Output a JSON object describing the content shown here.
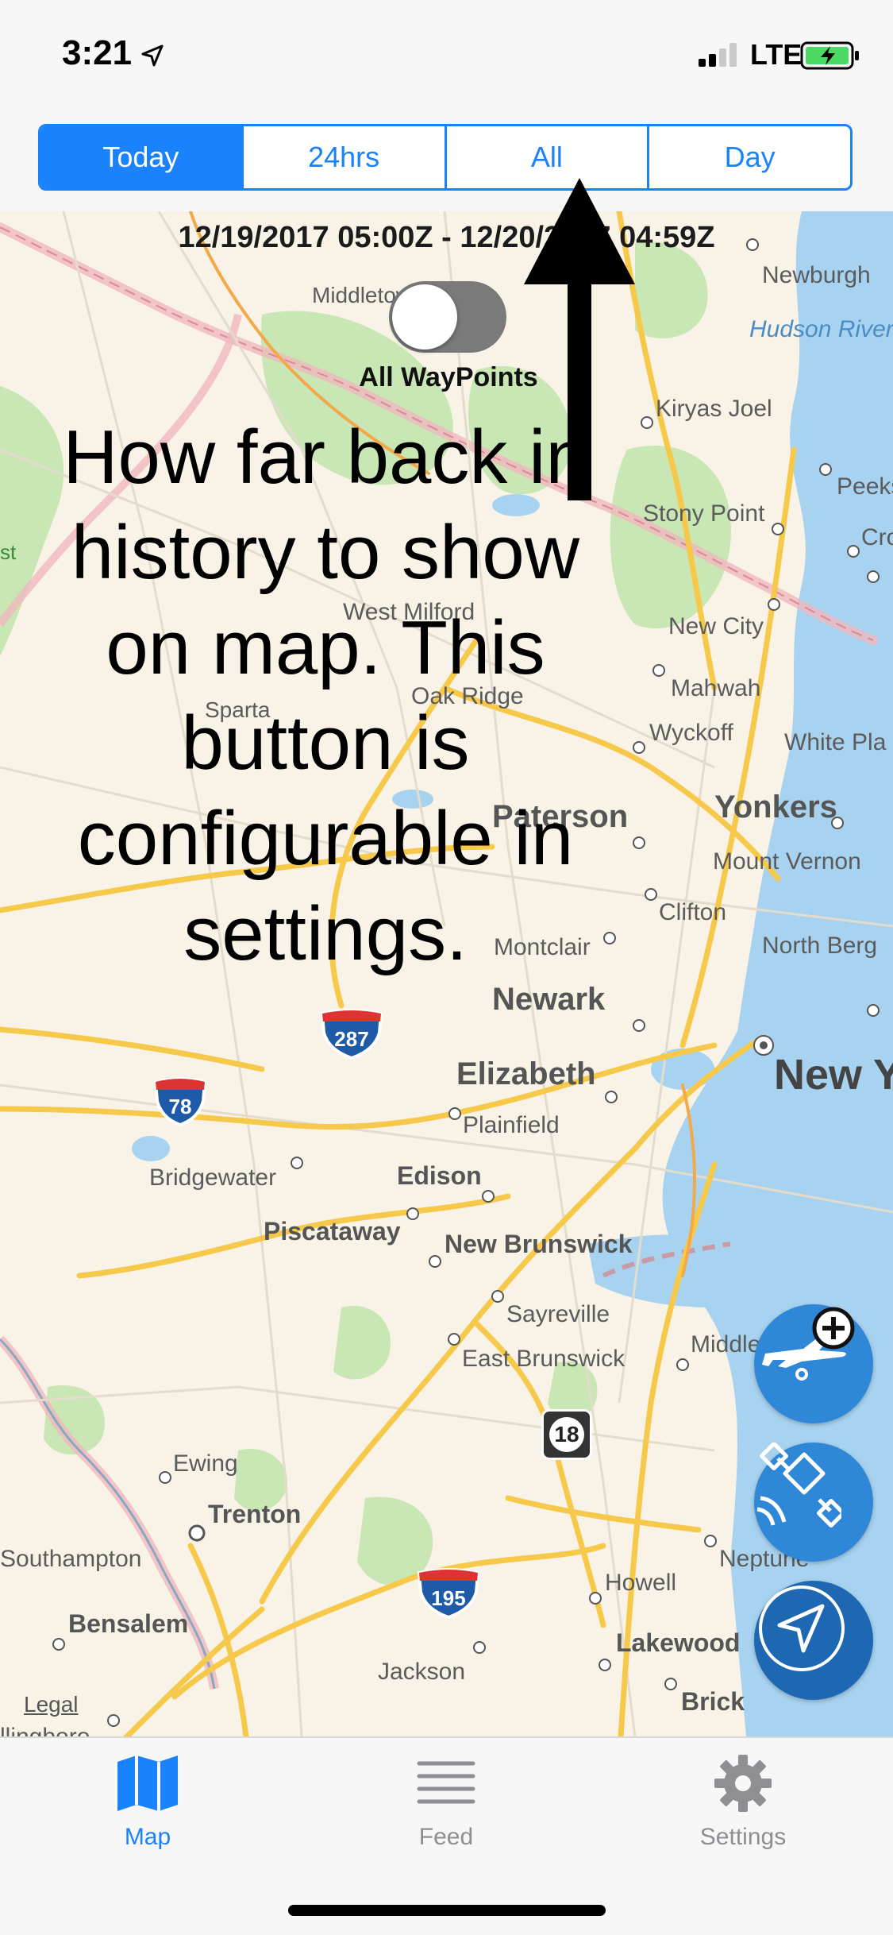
{
  "status": {
    "time": "3:21",
    "carrier": "LTE"
  },
  "segments": [
    {
      "label": "Today",
      "active": true
    },
    {
      "label": "24hrs",
      "active": false
    },
    {
      "label": "All",
      "active": false
    },
    {
      "label": "Day",
      "active": false
    }
  ],
  "map": {
    "date_range": "12/19/2017 05:00Z - 12/20/2017 04:59Z",
    "toggle_label": "All WayPoints",
    "toggle_on": false,
    "annotation": "How far back in history to show on map. This button is configurable in settings.",
    "legal": "Legal",
    "places": [
      "Newburgh",
      "Hudson River",
      "Kiryas Joel",
      "Peeks",
      "Stony Point",
      "Cro",
      "Middletown",
      "West Milford",
      "New City",
      "Mahwah",
      "Oak Ridge",
      "Sparta",
      "Wyckoff",
      "White Pla",
      "Paterson",
      "Yonkers",
      "Mount Vernon",
      "Clifton",
      "Montclair",
      "North Berg",
      "Newark",
      "New Y",
      "Elizabeth",
      "Plainfield",
      "Bridgewater",
      "Edison",
      "Piscataway",
      "New Brunswick",
      "Sayreville",
      "East Brunswick",
      "Middle",
      "Ewing",
      "Trenton",
      "Southampton",
      "Neptune",
      "Howell",
      "Bensalem",
      "Lakewood",
      "Jackson",
      "Brick",
      "llingboro",
      "st"
    ],
    "shields": {
      "i287": "287",
      "i78": "78",
      "i195": "195",
      "nj18": "18"
    }
  },
  "tabs": [
    {
      "label": "Map",
      "active": true
    },
    {
      "label": "Feed",
      "active": false
    },
    {
      "label": "Settings",
      "active": false
    }
  ],
  "colors": {
    "accent": "#1a82fb",
    "fab": "#2f87d8",
    "water": "#a7d3f0",
    "park": "#c9e6b5",
    "road": "#f6c94a"
  }
}
